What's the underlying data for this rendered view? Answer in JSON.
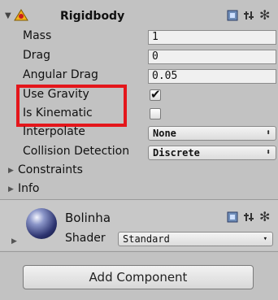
{
  "rigidbody": {
    "title": "Rigidbody",
    "component_icon": "rigidbody-icon",
    "header_icons": [
      "book-icon",
      "preset-icon",
      "gear-icon"
    ],
    "properties": {
      "mass": {
        "label": "Mass",
        "value": "1"
      },
      "drag": {
        "label": "Drag",
        "value": "0"
      },
      "angular_drag": {
        "label": "Angular Drag",
        "value": "0.05"
      },
      "use_gravity": {
        "label": "Use Gravity",
        "checked": true
      },
      "is_kinematic": {
        "label": "Is Kinematic",
        "checked": false
      },
      "interpolate": {
        "label": "Interpolate",
        "value": "None"
      },
      "collision_detection": {
        "label": "Collision Detection",
        "value": "Discrete"
      }
    },
    "foldouts": [
      {
        "label": "Constraints"
      },
      {
        "label": "Info"
      }
    ]
  },
  "material": {
    "name": "Bolinha",
    "shader_label": "Shader",
    "shader_value": "Standard",
    "header_icons": [
      "book-icon",
      "preset-icon",
      "gear-icon"
    ]
  },
  "add_component_label": "Add Component",
  "highlight_color": "#e4161b"
}
